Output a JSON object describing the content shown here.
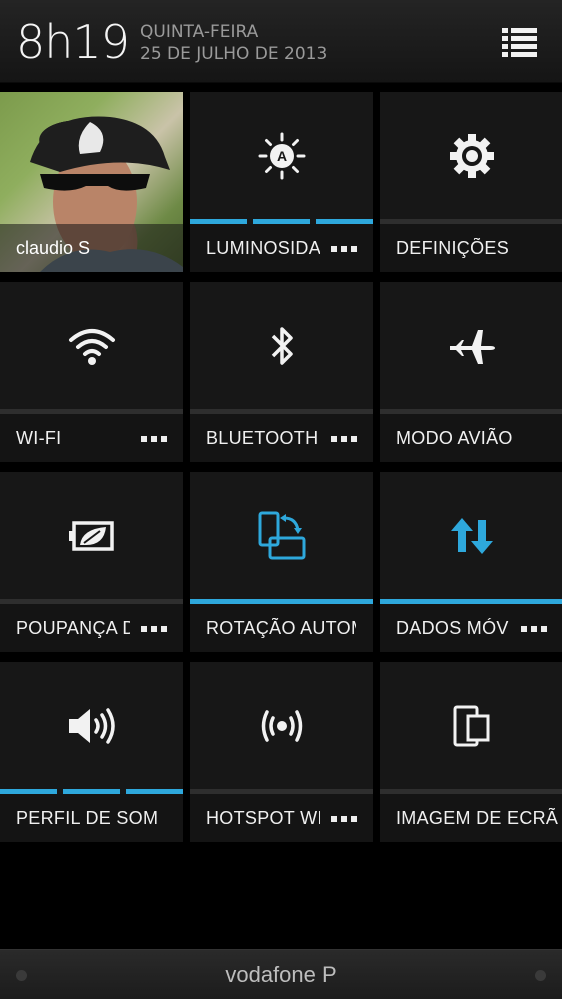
{
  "status": {
    "time": "8h19",
    "weekday": "QUINTA-FEIRA",
    "date": "25 DE JULHO DE 2013"
  },
  "menu": {
    "icon": "list-menu-icon"
  },
  "tiles": [
    {
      "id": "profile",
      "label": "claudio S",
      "icon": "profile-photo"
    },
    {
      "id": "brightness",
      "label": "LUMINOSIDADE",
      "icon": "auto-brightness-icon",
      "more": true,
      "level_segments_on": 3
    },
    {
      "id": "settings",
      "label": "DEFINIÇÕES",
      "icon": "gear-icon",
      "more": false
    },
    {
      "id": "wifi",
      "label": "WI-FI",
      "icon": "wifi-icon",
      "more": true,
      "on": false
    },
    {
      "id": "bluetooth",
      "label": "BLUETOOTH",
      "icon": "bluetooth-icon",
      "more": true,
      "on": false
    },
    {
      "id": "airplane",
      "label": "MODO AVIÃO",
      "icon": "airplane-icon",
      "more": false,
      "on": false
    },
    {
      "id": "power-saver",
      "label": "POUPANÇA DE ENERGIA",
      "icon": "battery-leaf-icon",
      "more": true,
      "on": false
    },
    {
      "id": "auto-rotate",
      "label": "ROTAÇÃO AUTOMÁTICA",
      "icon": "rotate-screen-icon",
      "more": false,
      "on": true
    },
    {
      "id": "mobile-data",
      "label": "DADOS MÓVEIS",
      "icon": "data-arrows-icon",
      "more": true,
      "on": true
    },
    {
      "id": "sound-profile",
      "label": "PERFIL DE SOM",
      "icon": "speaker-icon",
      "more": false,
      "level_segments_on": 3
    },
    {
      "id": "hotspot",
      "label": "HOTSPOT WI-FI",
      "icon": "hotspot-icon",
      "more": true,
      "on": false
    },
    {
      "id": "screen-mirror",
      "label": "IMAGEM DE ECRÃ",
      "icon": "screen-mirror-icon",
      "more": false,
      "on": false
    }
  ],
  "footer": {
    "carrier": "vodafone P"
  },
  "colors": {
    "accent": "#2ea8dc",
    "tile": "#171717",
    "background": "#000000"
  }
}
